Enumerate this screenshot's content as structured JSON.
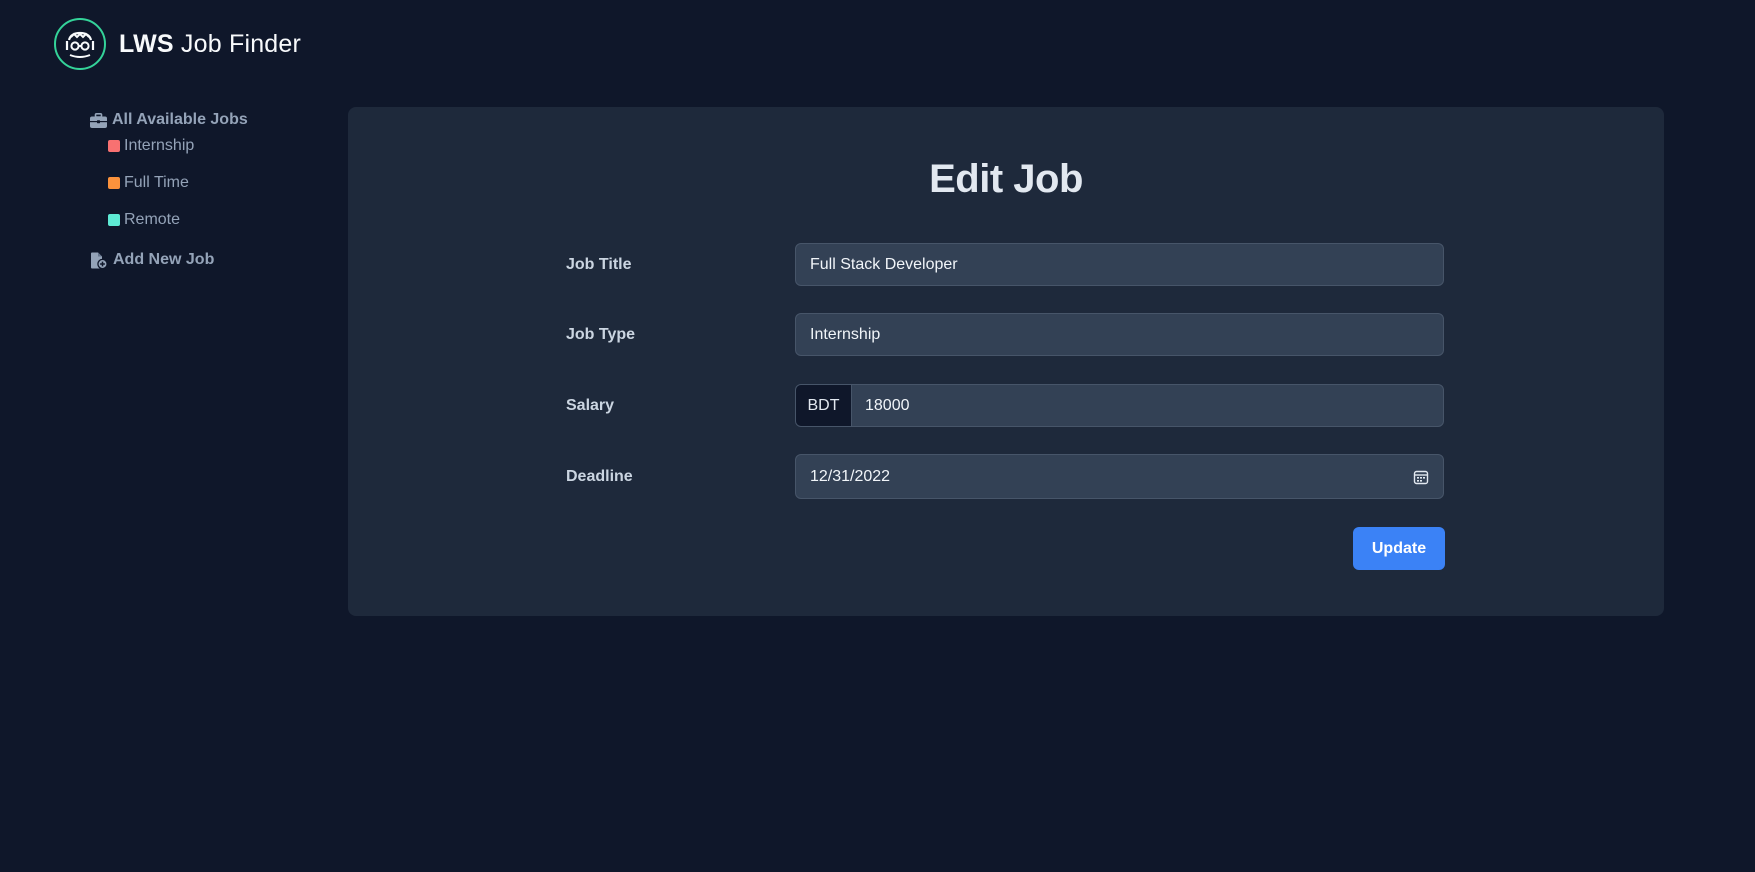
{
  "header": {
    "brand_bold": "LWS",
    "brand_rest": "Job Finder",
    "logo_icon": "developer-face-icon",
    "logo_ring_color": "#34d399"
  },
  "sidebar": {
    "all_jobs": {
      "label": "All Available Jobs",
      "icon": "briefcase-icon"
    },
    "filters": [
      {
        "label": "Internship",
        "color": "#f87171"
      },
      {
        "label": "Full Time",
        "color": "#fb923c"
      },
      {
        "label": "Remote",
        "color": "#5eead4"
      }
    ],
    "add_job": {
      "label": "Add New Job",
      "icon": "file-plus-icon"
    }
  },
  "form": {
    "title": "Edit Job",
    "job_title": {
      "label": "Job Title",
      "value": "Full Stack Developer"
    },
    "job_type": {
      "label": "Job Type",
      "value": "Internship"
    },
    "salary": {
      "label": "Salary",
      "prefix": "BDT",
      "value": "18000"
    },
    "deadline": {
      "label": "Deadline",
      "value": "12/31/2022",
      "icon": "calendar-icon"
    },
    "submit_label": "Update",
    "accent": "#3b82f6"
  }
}
